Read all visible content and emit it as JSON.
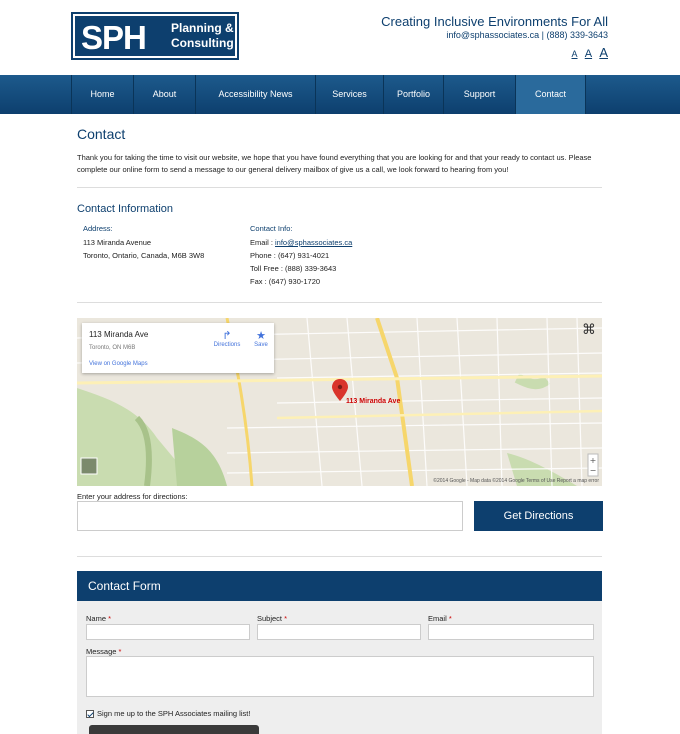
{
  "header": {
    "logo_main": "SPH",
    "logo_line1": "Planning &",
    "logo_line2": "Consulting",
    "tagline": "Creating Inclusive Environments For All",
    "contact_line": "info@sphassociates.ca | (888) 339-3643",
    "font_sizes": [
      "A",
      "A",
      "A"
    ]
  },
  "nav": {
    "items": [
      {
        "label": "Home",
        "width": 62
      },
      {
        "label": "About",
        "width": 62
      },
      {
        "label": "Accessibility News",
        "width": 120
      },
      {
        "label": "Services",
        "width": 68
      },
      {
        "label": "Portfolio",
        "width": 60
      },
      {
        "label": "Support",
        "width": 72
      },
      {
        "label": "Contact",
        "width": 70
      }
    ],
    "active": "Contact"
  },
  "page": {
    "title": "Contact",
    "intro": "Thank you for taking the time to visit our website, we hope that you have found everything that you are looking for and that your ready to contact us. Please complete our online form to send a message to our general delivery mailbox of give us a call, we look forward to hearing from you!"
  },
  "contact_info": {
    "heading": "Contact Information",
    "address_label": "Address:",
    "address_line1": "113 Miranda Avenue",
    "address_line2": "Toronto, Ontario, Canada, M6B 3W8",
    "info_label": "Contact Info:",
    "email_prefix": "Email : ",
    "email": "info@sphassociates.ca",
    "phone": "Phone : (647) 931-4021",
    "tollfree": "Toll Free : (888) 339-3643",
    "fax": "Fax : (647) 930-1720"
  },
  "map": {
    "card_title": "113 Miranda Ave",
    "card_address": "Toronto, ON M6B",
    "card_link": "View on Google Maps",
    "directions_label": "Directions",
    "save_label": "Save",
    "pin_label": "113 Miranda Ave",
    "footer": "©2014 Google - Map data ©2014 Google    Terms of Use    Report a map error"
  },
  "directions": {
    "label": "Enter your address for directions:",
    "button": "Get Directions"
  },
  "form": {
    "heading": "Contact Form",
    "name_label": "Name",
    "subject_label": "Subject",
    "email_label": "Email",
    "message_label": "Message",
    "required_mark": "*",
    "checkbox_label": "Sign me up to the SPH Associates mailing list!"
  },
  "colors": {
    "brand": "#0d3f6e",
    "nav_active": "#2a6a9c",
    "required": "#cc0000"
  }
}
